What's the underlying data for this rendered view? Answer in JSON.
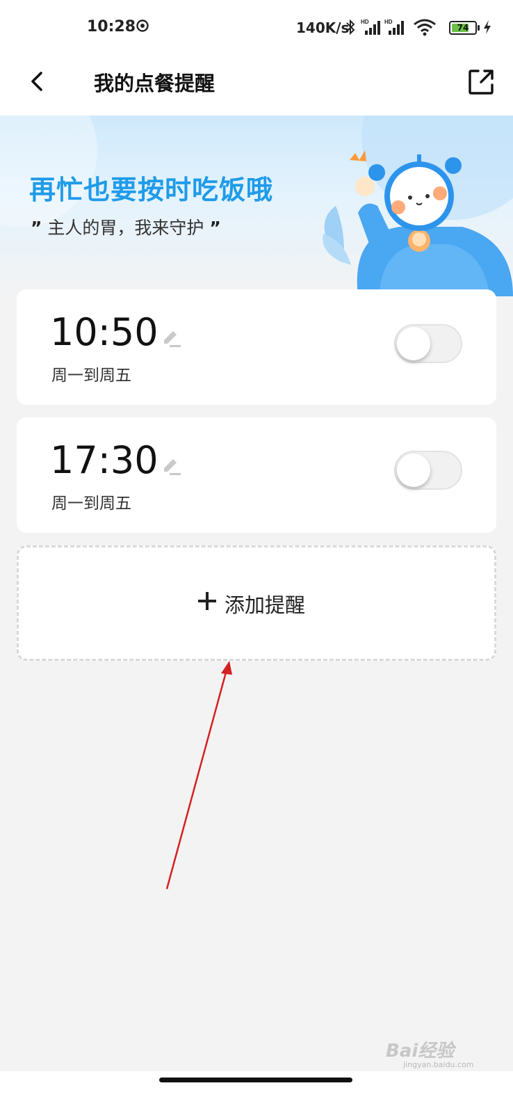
{
  "status_bar": {
    "time": "10:28",
    "net_speed": "140K/s",
    "battery_level": "74",
    "battery_fraction": 0.74,
    "icons": [
      "dnd-icon",
      "bluetooth-icon",
      "hd-signal-icon",
      "hd-signal-icon",
      "wifi-icon",
      "battery-icon",
      "charging-icon"
    ],
    "signal_badge": "HD"
  },
  "header": {
    "title": "我的点餐提醒",
    "back_icon": "chevron-left-icon",
    "share_icon": "share-icon"
  },
  "banner": {
    "headline": "再忙也要按时吃饭哦",
    "quote_open": "”",
    "subtitle": "主人的胃，我来守护",
    "quote_close": "”",
    "illustration": "alarm-clock-mascot"
  },
  "reminders": [
    {
      "time": "10:50",
      "days": "周一到周五",
      "enabled": false
    },
    {
      "time": "17:30",
      "days": "周一到周五",
      "enabled": false
    }
  ],
  "add_reminder": {
    "label": "添加提醒",
    "icon": "plus-icon"
  },
  "colors": {
    "accent_blue": "#1f9be9",
    "background": "#f3f3f3",
    "card": "#ffffff",
    "annotation_arrow": "#d42020"
  },
  "watermark": {
    "brand": "Bai经验",
    "url": "jingyan.baidu.com"
  }
}
